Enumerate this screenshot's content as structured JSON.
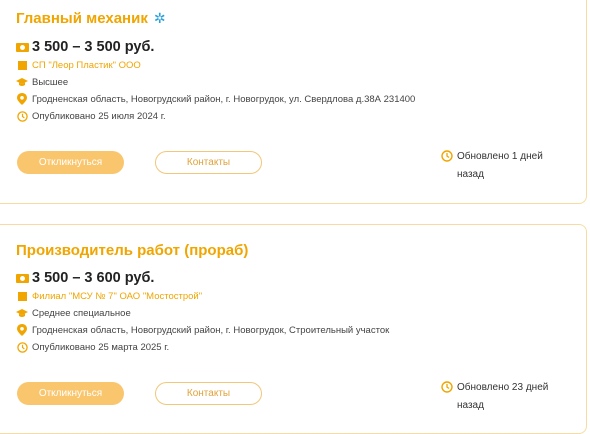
{
  "colors": {
    "accent": "#f0a500",
    "button_fill": "#f9c66e",
    "star": "#2a9fd8"
  },
  "icons": [
    "star-icon",
    "money-icon",
    "building-icon",
    "graduation-cap-icon",
    "location-pin-icon",
    "clock-icon"
  ],
  "vacancies": [
    {
      "title": "Главный механик",
      "salary": "3 500 – 3 500 руб.",
      "company": "СП \"Леор Пластик\" ООО",
      "education": "Высшее",
      "location": "Гродненская область, Новогрудский район, г. Новогрудок, ул. Свердлова д.38А 231400",
      "published": "Опубликовано 25 июля 2024 г.",
      "apply_label": "Откликнуться",
      "contacts_label": "Контакты",
      "updated_line1": "Обновлено 1 дней",
      "updated_line2": "назад"
    },
    {
      "title": "Производитель работ (прораб)",
      "salary": "3 500 – 3 600 руб.",
      "company": "Филиал \"МСУ № 7\" ОАО \"Мостострой\"",
      "education": "Среднее специальное",
      "location": "Гродненская область, Новогрудский район, г. Новогрудок, Строительный участок",
      "published": "Опубликовано 25 марта 2025 г.",
      "apply_label": "Откликнуться",
      "contacts_label": "Контакты",
      "updated_line1": "Обновлено 23 дней",
      "updated_line2": "назад"
    }
  ]
}
